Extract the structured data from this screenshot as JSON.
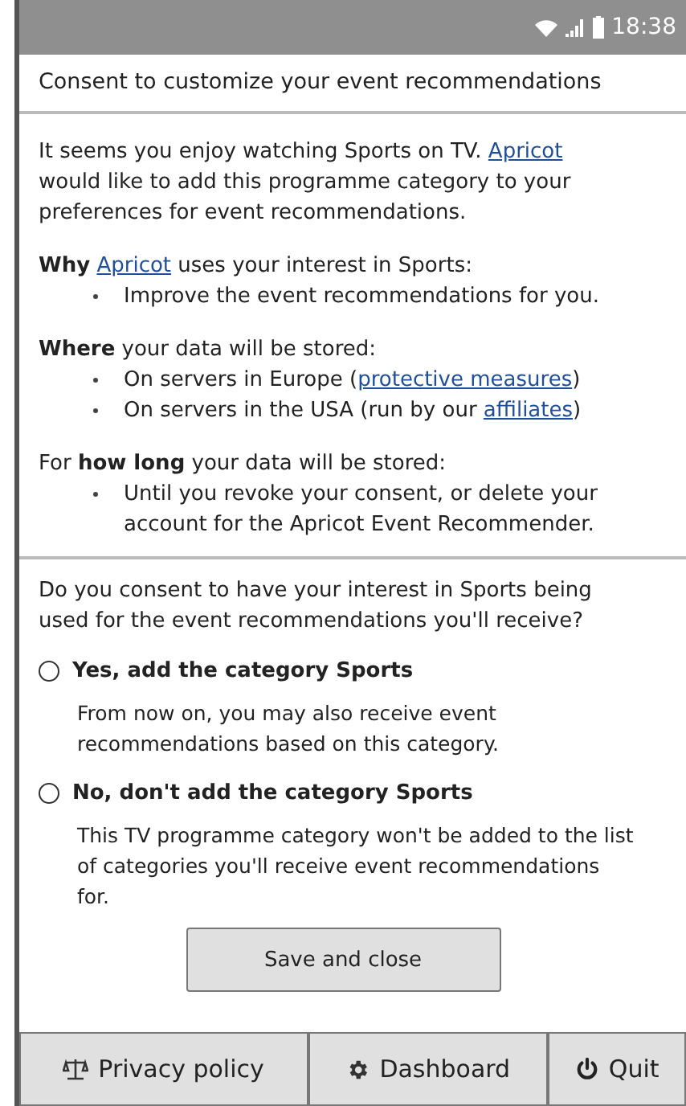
{
  "status_bar": {
    "time": "18:38"
  },
  "title": "Consent to customize your event recommendations",
  "sections": [
    {
      "paragraph": [
        {
          "kind": "text",
          "text": "It seems you enjoy watching Sports on TV. "
        },
        {
          "kind": "link",
          "text": "Apricot"
        },
        {
          "kind": "text",
          "text": " would like to add this programme category to your preferences for event recommendations."
        }
      ]
    },
    {
      "paragraph": [
        {
          "kind": "text",
          "text": "**Why** "
        },
        {
          "kind": "link",
          "text": "Apricot"
        },
        {
          "kind": "text",
          "text": " uses your interest in Sports:"
        }
      ],
      "bullets": [
        [
          {
            "kind": "text",
            "text": "Improve the event recommendations for you."
          }
        ]
      ]
    },
    {
      "paragraph": [
        {
          "kind": "text",
          "text": "**Where** your data will be stored:"
        }
      ],
      "bullets": [
        [
          {
            "kind": "text",
            "text": "On servers in Europe ("
          },
          {
            "kind": "link",
            "text": "protective measures"
          },
          {
            "kind": "text",
            "text": ")"
          }
        ],
        [
          {
            "kind": "text",
            "text": "On servers in the USA (run by our "
          },
          {
            "kind": "link",
            "text": "affiliates"
          },
          {
            "kind": "text",
            "text": ")"
          }
        ]
      ]
    },
    {
      "paragraph": [
        {
          "kind": "text",
          "text": "For **how long** your data will be stored:"
        }
      ],
      "bullets": [
        [
          {
            "kind": "text",
            "text": "Until you revoke your consent, or delete your account for the Apricot Event Recommender."
          }
        ]
      ]
    }
  ],
  "question": "Do you consent to have your interest in Sports being used for the event recommendations you'll receive?",
  "options": [
    {
      "label": "Yes, add the category Sports",
      "description": "From now on, you may also receive event recommendations based on this category.",
      "selected": false
    },
    {
      "label": "No, don't add the category Sports",
      "description": "This TV programme category won't be added to the list of categories you'll receive event recommendations for.",
      "selected": false
    }
  ],
  "save_button": "Save and close",
  "bottom_buttons": [
    {
      "kind": "privacy",
      "label": "Privacy policy"
    },
    {
      "kind": "dashboard",
      "label": "Dashboard"
    },
    {
      "kind": "quit",
      "label": "Quit"
    }
  ]
}
